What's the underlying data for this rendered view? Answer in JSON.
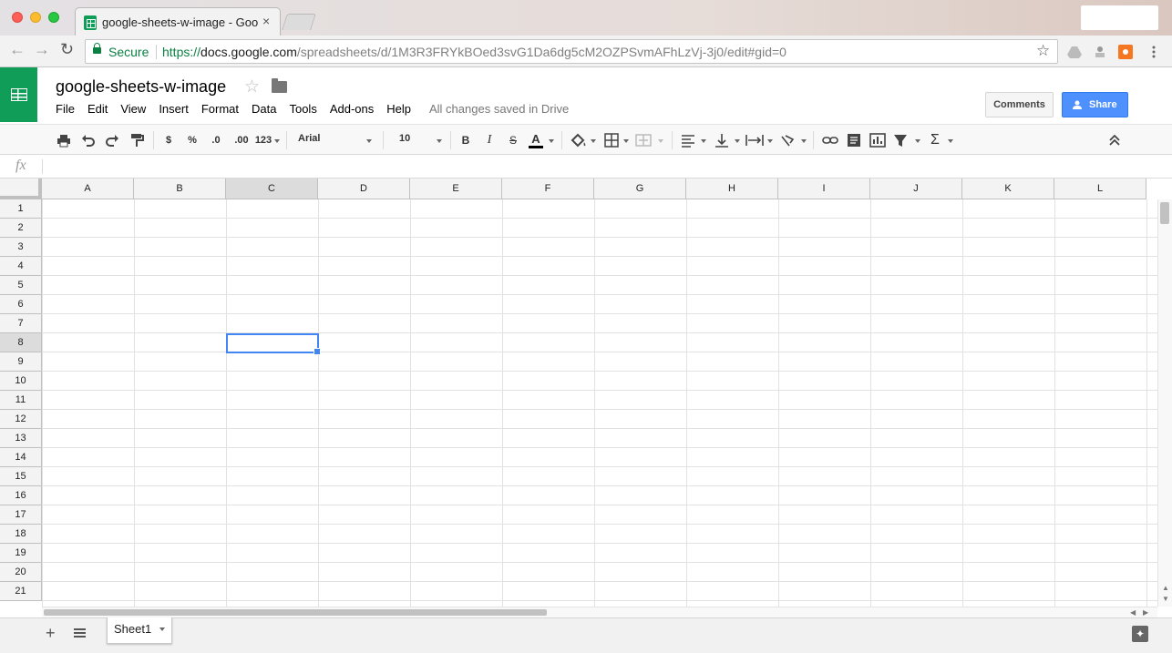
{
  "browser": {
    "tab_title": "google-sheets-w-image - Goo",
    "tab_close": "×",
    "secure_label": "Secure",
    "url_scheme": "https://",
    "url_host": "docs.google.com",
    "url_path": "/spreadsheets/d/1M3R3FRYkBOed3svG1Da6dg5cM2OZPSvmAFhLzVj-3j0/edit#gid=0",
    "back_icon": "←",
    "forward_icon": "→",
    "reload_icon": "↻",
    "star_icon": "☆"
  },
  "doc": {
    "title": "google-sheets-w-image",
    "star_icon": "☆"
  },
  "menu": {
    "items": [
      "File",
      "Edit",
      "View",
      "Insert",
      "Format",
      "Data",
      "Tools",
      "Add-ons",
      "Help"
    ],
    "save_status": "All changes saved in Drive"
  },
  "header_buttons": {
    "comments": "Comments",
    "share": "Share"
  },
  "toolbar": {
    "currency": "$",
    "percent": "%",
    "decrease_decimal": ".0",
    "increase_decimal": ".00",
    "more_formats": "123",
    "font": "Arial",
    "font_size": "10",
    "bold": "B",
    "italic": "I",
    "strikethrough": "S",
    "text_color_label": "A",
    "text_color": "#000000",
    "functions": "Σ",
    "collapse": "⌃"
  },
  "formula_bar": {
    "fx_label": "fx",
    "value": ""
  },
  "grid": {
    "columns": [
      "A",
      "B",
      "C",
      "D",
      "E",
      "F",
      "G",
      "H",
      "I",
      "J",
      "K",
      "L"
    ],
    "rows": [
      "1",
      "2",
      "3",
      "4",
      "5",
      "6",
      "7",
      "8",
      "9",
      "10",
      "11",
      "12",
      "13",
      "14",
      "15",
      "16",
      "17",
      "18",
      "19",
      "20",
      "21"
    ],
    "active_cell": "C8",
    "active_column": "C",
    "active_row": "8",
    "selection_color": "#4285f4"
  },
  "sheets": {
    "add_icon": "+",
    "tabs": [
      "Sheet1"
    ]
  },
  "colors": {
    "sheets_green": "#0f9d58",
    "share_blue": "#4d90fe",
    "secure_green": "#0b8043"
  }
}
